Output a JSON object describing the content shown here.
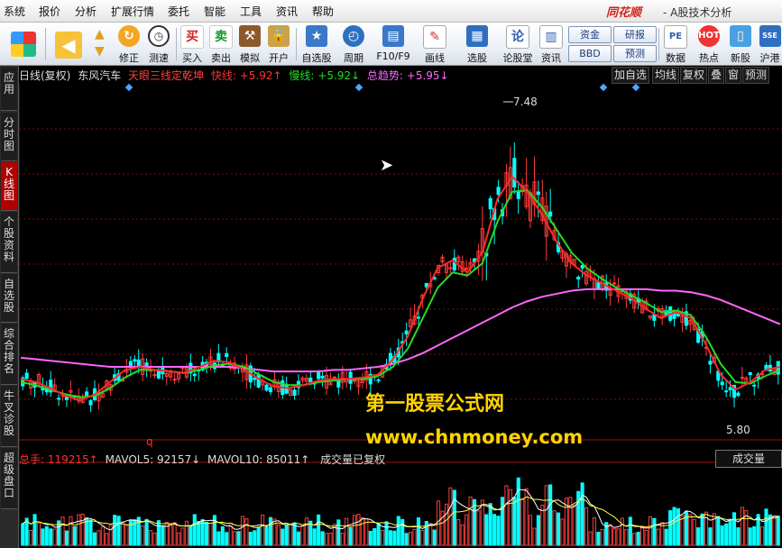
{
  "menu": [
    "系统",
    "报价",
    "分析",
    "扩展行情",
    "委托",
    "智能",
    "工具",
    "资讯",
    "帮助"
  ],
  "brand": "同花顺",
  "window_subtitle": "- A股技术分析",
  "toolbar": {
    "buttons": [
      "修正",
      "测速",
      "买入",
      "卖出",
      "模拟",
      "开户",
      "自选股",
      "周期",
      "F10/F9",
      "画线",
      "选股",
      "论股堂",
      "资讯",
      "数据",
      "热点",
      "新股",
      "沪港"
    ],
    "small_buttons": [
      "资金",
      "BBD",
      "研报",
      "预测"
    ]
  },
  "sidebar_tabs": [
    "应用",
    "分时图",
    "K线图",
    "个股资料",
    "自选股",
    "综合排名",
    "牛叉诊股",
    "超级盘口"
  ],
  "chart_header": {
    "period": "日线(复权)",
    "stock": "东风汽车",
    "indicator": "天眼三线定乾坤",
    "fast": "快线: +5.92↑",
    "slow": "慢线: +5.92↓",
    "trend": "总趋势: +5.95↓",
    "right_buttons": [
      "加自选",
      "均线",
      "复权",
      "叠",
      "窗",
      "预测"
    ]
  },
  "price_labels": {
    "high": "7.48",
    "low": "5.80"
  },
  "volume_header": {
    "total": "总手: 119215↑",
    "mavol5": "MAVOL5: 92157↓",
    "mavol10": "MAVOL10: 85011↑",
    "status": "成交量已复权",
    "q_marker": "q",
    "button": "成交量"
  },
  "watermark": {
    "line1": "第一股票公式网",
    "line2": "www.chnmoney.com"
  },
  "colors": {
    "up": "#ff3b3b",
    "down": "#00ffff",
    "fast": "#ff2a2a",
    "slow": "#22dd22",
    "trend": "#ff66ff",
    "watermark": "#ffd400"
  },
  "chart_data": {
    "type": "candlestick",
    "high_label": 7.48,
    "low_label": 5.8,
    "fast_line": [
      5.72,
      5.7,
      5.66,
      5.61,
      5.58,
      5.62,
      5.7,
      5.78,
      5.8,
      5.78,
      5.77,
      5.76,
      5.8,
      5.84,
      5.83,
      5.78,
      5.72,
      5.67,
      5.66,
      5.68,
      5.71,
      5.72,
      5.72,
      5.73,
      5.75,
      5.85,
      6.0,
      6.25,
      6.45,
      6.5,
      6.42,
      6.55,
      6.9,
      7.05,
      6.95,
      6.8,
      6.62,
      6.48,
      6.4,
      6.35,
      6.3,
      6.25,
      6.18,
      6.12,
      6.16,
      6.12,
      5.95,
      5.75,
      5.65,
      5.7,
      5.78,
      5.8
    ],
    "slow_line": [
      5.7,
      5.68,
      5.65,
      5.62,
      5.6,
      5.61,
      5.66,
      5.73,
      5.78,
      5.78,
      5.77,
      5.76,
      5.78,
      5.81,
      5.82,
      5.8,
      5.75,
      5.7,
      5.68,
      5.68,
      5.7,
      5.71,
      5.72,
      5.72,
      5.74,
      5.8,
      5.92,
      6.12,
      6.32,
      6.42,
      6.4,
      6.48,
      6.75,
      6.95,
      6.96,
      6.85,
      6.7,
      6.55,
      6.45,
      6.38,
      6.32,
      6.27,
      6.22,
      6.16,
      6.17,
      6.14,
      6.0,
      5.82,
      5.7,
      5.69,
      5.74,
      5.78
    ],
    "trend_line": [
      5.86,
      5.85,
      5.84,
      5.83,
      5.82,
      5.81,
      5.8,
      5.8,
      5.8,
      5.8,
      5.8,
      5.8,
      5.8,
      5.8,
      5.8,
      5.79,
      5.78,
      5.77,
      5.77,
      5.77,
      5.77,
      5.78,
      5.78,
      5.79,
      5.8,
      5.82,
      5.85,
      5.89,
      5.94,
      5.99,
      6.04,
      6.09,
      6.14,
      6.19,
      6.23,
      6.26,
      6.28,
      6.3,
      6.31,
      6.31,
      6.31,
      6.31,
      6.31,
      6.3,
      6.3,
      6.29,
      6.27,
      6.24,
      6.2,
      6.16,
      6.12,
      6.08
    ]
  }
}
